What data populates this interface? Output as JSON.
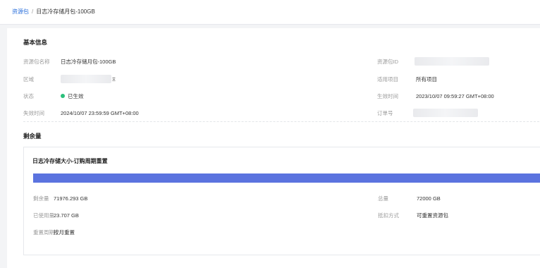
{
  "breadcrumb": {
    "root": "资源包",
    "separator": "/",
    "current": "日志冷存储月包-100GB"
  },
  "basic_info": {
    "title": "基本信息",
    "fields": {
      "name_label": "资源包名称",
      "name_value": "日志冷存储月包-100GB",
      "id_label": "资源包ID",
      "region_label": "区域",
      "region_suffix": "Ξ",
      "project_label": "适用项目",
      "project_value": "所有项目",
      "status_label": "状态",
      "status_value": "已生效",
      "effective_label": "生效时间",
      "effective_value": "2023/10/07 09:59:27 GMT+08:00",
      "expire_label": "失效时间",
      "expire_value": "2024/10/07 23:59:59 GMT+08:00",
      "order_label": "订单号"
    }
  },
  "remaining": {
    "title": "剩余量",
    "card_title": "日志冷存储大小-订购周期重置",
    "usage_fraction": 0.9997,
    "fields": {
      "remaining_label": "剩余量",
      "remaining_value": "71976.293 GB",
      "total_label": "总量",
      "total_value": "72000 GB",
      "used_label": "已使用量",
      "used_value": "23.707 GB",
      "deduct_label": "抵扣方式",
      "deduct_value": "可重置资源包",
      "cycle_label": "重置周期",
      "cycle_value": "按月重置"
    }
  },
  "colors": {
    "accent": "#2a6fdb",
    "progress": "#5b73df",
    "status_active": "#2bbf7b"
  }
}
